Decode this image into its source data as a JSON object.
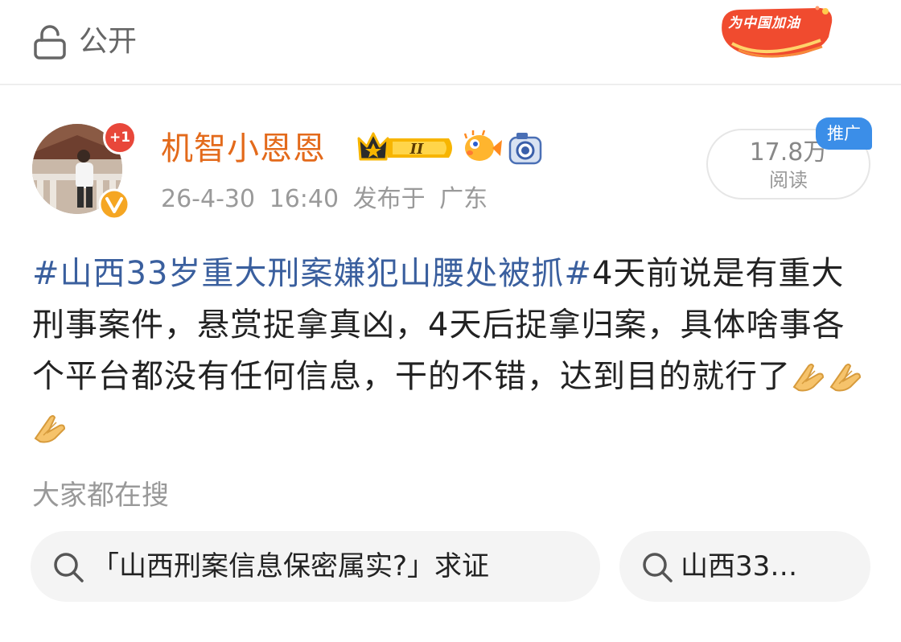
{
  "header": {
    "visibility_label": "公开",
    "visibility_icon": "unlock-icon",
    "campaign_badge": "为中国加油"
  },
  "post": {
    "author": {
      "name": "机智小恩恩",
      "notification_count": "+1",
      "verified_icon": "verified-v-icon",
      "crown_level": "II"
    },
    "timestamp": "26-4-30 16:40",
    "location": "发布于 广东",
    "reads": {
      "count": "17.8万",
      "label": "阅读",
      "promo_tag": "推广"
    },
    "hashtag": "#山西33岁重大刑案嫌犯山腰处被抓#",
    "body": "4天前说是有重大刑事案件，悬赏捉拿真凶，4天后捉拿归案，具体啥事各个平台都没有任何信息，干的不错，达到目的就行了",
    "emojis": [
      "folded-hands-emoji",
      "folded-hands-emoji",
      "folded-hands-emoji"
    ]
  },
  "search": {
    "heading": "大家都在搜",
    "chips": [
      {
        "text": "「山西刑案信息保密属实?」求证",
        "icon": "search-icon"
      },
      {
        "text": "山西33…",
        "icon": "search-icon"
      }
    ]
  },
  "colors": {
    "username": "#e36a1b",
    "hashtag": "#3a5f9e",
    "promo_badge": "#3b8ee8",
    "notification_badge": "#e8473a"
  }
}
